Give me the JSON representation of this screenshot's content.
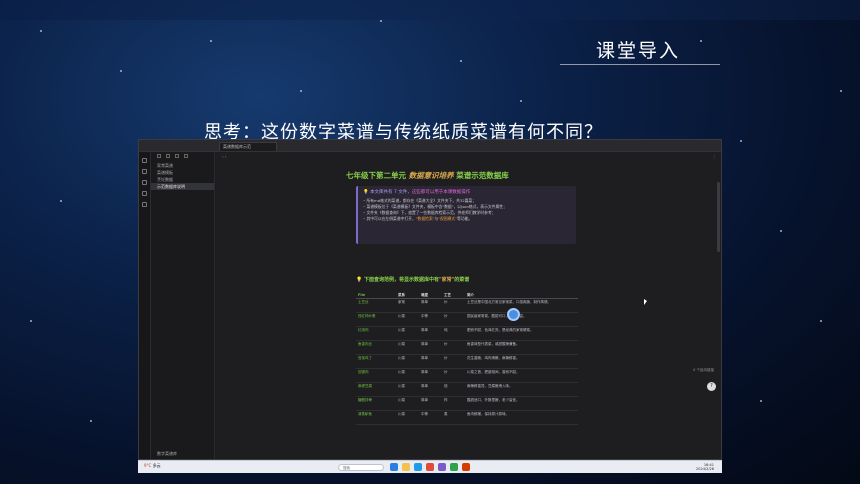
{
  "slide": {
    "title": "课堂导入",
    "question": "思考：这份数字菜谱与传统纸质菜谱有何不同？"
  },
  "app": {
    "tab_label": "菜谱数据库示范",
    "tree": [
      {
        "label": "家常菜谱"
      },
      {
        "label": "菜谱模板"
      },
      {
        "label": "烹饪数据"
      },
      {
        "label": "示范数据库说明"
      }
    ],
    "tree_footer": "数字菜谱库",
    "doc_title_prefix": "七年级下第二单元",
    "doc_title_highlight": "数据意识培养",
    "doc_title_suffix": "菜谱示范数据库",
    "callout_title": "本文库共有 7 文件，",
    "callout_title_hl": "这些都可以用于本课数据操作",
    "callout_items": [
      "所有md格式的菜谱，都存在《菜谱大全》文件夹下，共32篇菜；",
      "菜谱模板位于《菜谱模板》文件夹，模板中含\"数据\"，以Json格式，表示文件属性；",
      "文件夹《数据查询》下，放置了一些数据库检索示范，供老师们教学时参考；",
      "其中可以在左侧菜谱中打开，"
    ],
    "callout_item4_hl1": "\"数据检索\"",
    "callout_item4_hl2": "\"视图模式\"",
    "callout_item4_tail": "等功能。",
    "section_prefix": "下面查询范例，将显示数据库中有",
    "section_hl": "\"家常\"",
    "section_suffix": "的菜谱",
    "table_headers": [
      "File",
      "菜系",
      "难度",
      "工艺",
      "简介"
    ],
    "table_rows": [
      [
        "土豆丝",
        "家常",
        "简单",
        "炒",
        "土豆丝是中国北方常见家常菜，口感爽脆，制作简便。"
      ],
      [
        "西红柿炒蛋",
        "川菜",
        "中等",
        "炒",
        "国民级家常菜，酸甜可口，营养丰富。"
      ],
      [
        "红烧肉",
        "川菜",
        "简单",
        "炖",
        "肥而不腻，色泽红亮，是经典的家常硬菜。"
      ],
      [
        "鱼香肉丝",
        "川菜",
        "简单",
        "炒",
        "鱼香味型代表菜，咸甜酸辣兼备。"
      ],
      [
        "宫保鸡丁",
        "川菜",
        "简单",
        "炒",
        "花生香脆，鸡肉滑嫩，麻辣鲜香。"
      ],
      [
        "回锅肉",
        "川菜",
        "简单",
        "炒",
        "川菜之首，肥瘦相间，香而不腻。"
      ],
      [
        "麻婆豆腐",
        "川菜",
        "简单",
        "烧",
        "麻辣鲜香烫，豆腐嫩滑入味。"
      ],
      [
        "糖醋排骨",
        "川菜",
        "简单",
        "炸",
        "酸甜适口，外酥里嫩，老少皆宜。"
      ],
      [
        "清蒸鲈鱼",
        "川菜",
        "中等",
        "蒸",
        "鱼肉鲜嫩，保持原汁原味。"
      ]
    ],
    "status_text": "0 个反向链接"
  },
  "taskbar": {
    "weather_temp": "9°C",
    "weather_text": "多云",
    "search_placeholder": "搜索",
    "tray_time": "16:41",
    "tray_date": "2024/2/26"
  },
  "colors": {
    "accent_green": "#8ad14a",
    "accent_orange": "#d6a84a",
    "callout_border": "#7b6cc9"
  }
}
